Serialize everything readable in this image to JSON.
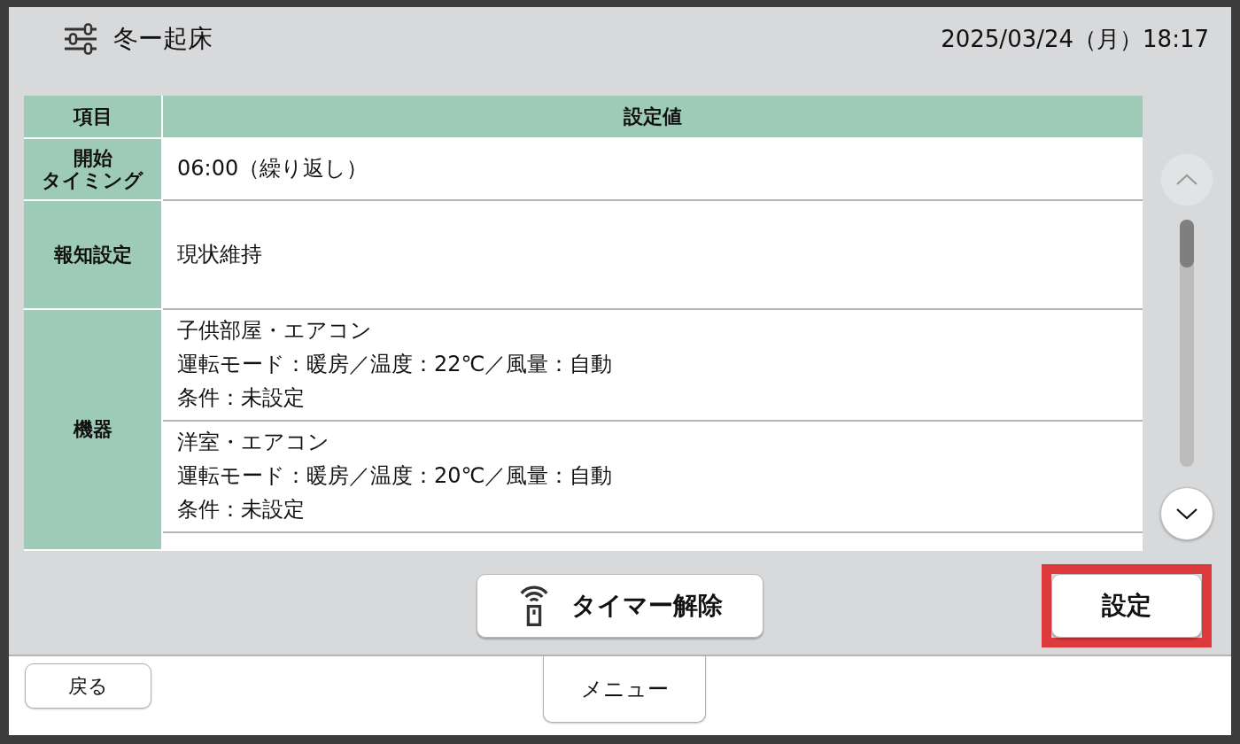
{
  "header": {
    "title": "冬ー起床",
    "datetime": "2025/03/24（月）18:17"
  },
  "table": {
    "columns": [
      "項目",
      "設定値"
    ],
    "rows": [
      {
        "label": [
          "開始",
          "タイミング"
        ],
        "entries": [
          {
            "lines": [
              "06:00（繰り返し）"
            ]
          }
        ]
      },
      {
        "label": [
          "報知設定"
        ],
        "entries": [
          {
            "lines": [
              "現状維持"
            ]
          }
        ]
      },
      {
        "label": [
          "機器"
        ],
        "entries": [
          {
            "lines": [
              "子供部屋・エアコン",
              "運転モード：暖房／温度：22℃／風量：自動",
              "条件：未設定"
            ]
          },
          {
            "lines": [
              "洋室・エアコン",
              "運転モード：暖房／温度：20℃／風量：自動",
              "条件：未設定"
            ]
          }
        ]
      }
    ]
  },
  "scroll_buttons": [
    {
      "kind": "up",
      "disabled": true
    },
    {
      "kind": "down",
      "disabled": false
    }
  ],
  "actions": [
    {
      "kind": "timer-cancel",
      "label": "タイマー解除",
      "highlighted": false
    },
    {
      "kind": "confirm",
      "label": "設定",
      "highlighted": true
    }
  ],
  "footer": {
    "back": "戻る",
    "menu": "メニュー"
  }
}
